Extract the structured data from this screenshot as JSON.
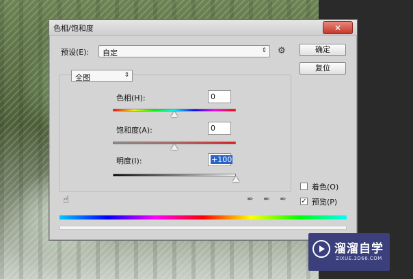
{
  "dialog": {
    "title": "色相/饱和度",
    "close_label": "✕"
  },
  "preset": {
    "label": "预设(E):",
    "value": "自定",
    "gear_icon": "gear-icon"
  },
  "buttons": {
    "ok": "确定",
    "reset": "复位"
  },
  "channel": {
    "value": "全图"
  },
  "hue": {
    "label": "色相(H):",
    "value": "0"
  },
  "saturation": {
    "label": "饱和度(A):",
    "value": "0"
  },
  "lightness": {
    "label": "明度(I):",
    "value": "+100"
  },
  "options": {
    "colorize_label": "着色(O)",
    "colorize_checked": false,
    "preview_label": "预览(P)",
    "preview_checked": true
  },
  "watermark": {
    "title": "溜溜自学",
    "subtitle": "ZIXUE.3D66.COM"
  }
}
